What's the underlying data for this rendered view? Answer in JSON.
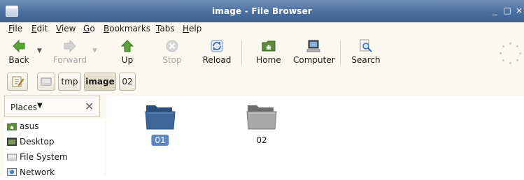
{
  "window": {
    "title": "image - File Browser",
    "controls": [
      "_",
      "□",
      "×"
    ]
  },
  "menu": [
    {
      "label": "File",
      "mnemonic": "F",
      "rest": "ile"
    },
    {
      "label": "Edit",
      "mnemonic": "E",
      "rest": "dit"
    },
    {
      "label": "View",
      "mnemonic": "V",
      "rest": "iew"
    },
    {
      "label": "Go",
      "mnemonic": "G",
      "rest": "o"
    },
    {
      "label": "Bookmarks",
      "mnemonic": "B",
      "rest": "ookmarks"
    },
    {
      "label": "Tabs",
      "mnemonic": "T",
      "rest": "abs"
    },
    {
      "label": "Help",
      "mnemonic": "H",
      "rest": "elp"
    }
  ],
  "toolbar": {
    "back": "Back",
    "forward": "Forward",
    "up": "Up",
    "stop": "Stop",
    "reload": "Reload",
    "home": "Home",
    "computer": "Computer",
    "search": "Search"
  },
  "pathbar": {
    "segments": [
      "tmp",
      "image",
      "02"
    ],
    "active": "image"
  },
  "sidebar": {
    "header": "Places",
    "items": [
      {
        "label": "asus",
        "icon": "home-folder-icon"
      },
      {
        "label": "Desktop",
        "icon": "desktop-icon"
      },
      {
        "label": "File System",
        "icon": "drive-icon"
      },
      {
        "label": "Network",
        "icon": "network-icon"
      }
    ]
  },
  "files": [
    {
      "name": "01",
      "selected": true
    },
    {
      "name": "02",
      "selected": false
    }
  ],
  "colors": {
    "titlebar": "#4a6f9f",
    "selection": "#5e88bd",
    "folder_selected": "#3d6799",
    "folder": "#9a9a9a"
  }
}
